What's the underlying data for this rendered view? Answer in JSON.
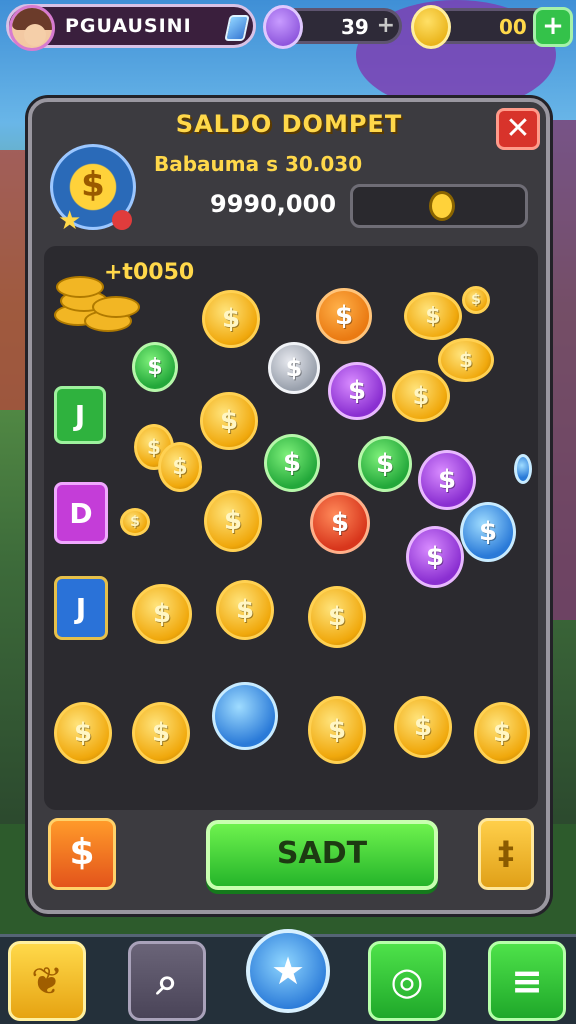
{
  "player": {
    "name": "PGUAUSINI"
  },
  "resources": {
    "gems": {
      "value": "39",
      "plus": "+"
    },
    "gold": {
      "value": "00",
      "plus": "+"
    }
  },
  "panel": {
    "title": "SALDO DOMPET",
    "close_label": "✕",
    "balance_label": "Babauma s 30.030",
    "balance_amount": "9990,000",
    "reward_header": "+t0050"
  },
  "items": {
    "coin_symbol": "$",
    "tile_green_symbol": "J",
    "tile_pink_symbol": "D",
    "tile_blue_symbol": "J"
  },
  "actions": {
    "main_button": "SADT",
    "left_button": "$",
    "right_button": "‡"
  },
  "bottom_nav": {
    "search_icon": "⌕",
    "star_icon": "★",
    "chat_icon": "◎",
    "menu_icon": "≡"
  },
  "colors": {
    "accent": "#ffd84a",
    "panel": "#3c3b40",
    "primary_button": "#25b52a",
    "danger": "#d8332b"
  }
}
